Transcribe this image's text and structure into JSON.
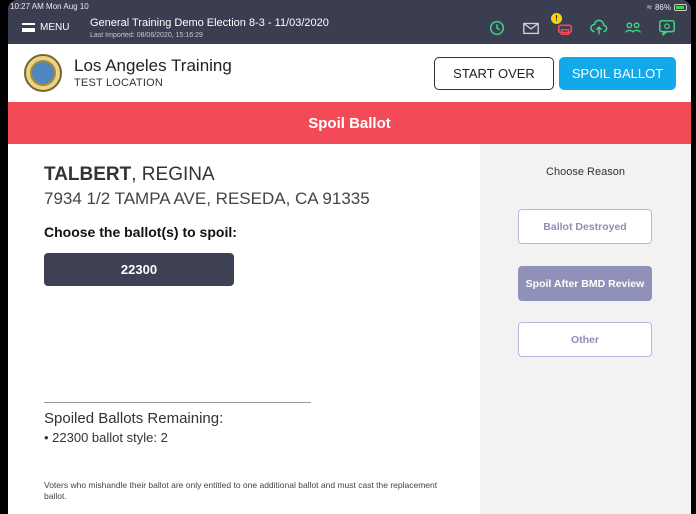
{
  "status_bar": {
    "time": "10:27 AM  Mon Aug 10",
    "battery": "86%"
  },
  "topbar": {
    "menu_label": "MENU",
    "election_title": "General Training  Demo Election 8-3 - 11/03/2020",
    "last_imported": "Last Imported: 08/06/2020, 15:16:29",
    "badge_count": "!",
    "icons": [
      "history-icon",
      "mail-icon",
      "printer-icon",
      "cloud-upload-icon",
      "users-icon",
      "chat-icon"
    ],
    "icon_color": "#3ddc84"
  },
  "header": {
    "org_name": "Los Angeles Training",
    "location": "TEST LOCATION",
    "start_over_label": "START OVER",
    "spoil_ballot_label": "SPOIL BALLOT"
  },
  "page_title": "Spoil Ballot",
  "voter": {
    "last_name": "TALBERT",
    "first_name": ", REGINA",
    "address": "7934 1/2 TAMPA AVE, RESEDA, CA 91335"
  },
  "choose_ballot_label": "Choose the ballot(s) to spoil:",
  "ballots": [
    {
      "style": "22300"
    }
  ],
  "remaining": {
    "title": "Spoiled Ballots Remaining:",
    "items": [
      "• 22300 ballot style: 2"
    ]
  },
  "notice": "Voters who mishandle their ballot are only entitled to one additional ballot and must cast the replacement ballot.",
  "reason_panel": {
    "title": "Choose Reason",
    "options": [
      {
        "label": "Ballot Destroyed",
        "selected": false
      },
      {
        "label": "Spoil After BMD Review",
        "selected": true
      },
      {
        "label": "Other",
        "selected": false
      }
    ]
  },
  "colors": {
    "topbar": "#3b3e50",
    "accent_red": "#f24b57",
    "accent_blue": "#12a9e8",
    "ballot_button": "#3e4154",
    "reason_selected": "#8f91b8"
  }
}
